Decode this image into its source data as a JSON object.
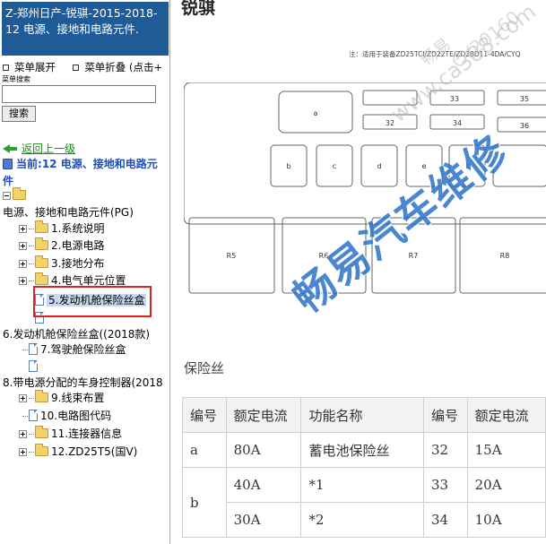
{
  "nav": {
    "title": "Z-郑州日产-锐骐-2015-2018- 12 电源、接地和电路元件.",
    "menu_expand": "菜单展开",
    "menu_collapse": "菜单折叠",
    "menu_hint": "(点击+",
    "search_label": "菜单搜索",
    "search_value": "",
    "search_button": "搜索",
    "back_link": "返回上一级",
    "current_prefix": "当前:",
    "current_name": "12 电源、接地和电路元件"
  },
  "tree": {
    "root_label": "电源、接地和电路元件(PG)",
    "items": [
      {
        "label": "1.系统说明"
      },
      {
        "label": "2.电源电路"
      },
      {
        "label": "3.接地分布"
      },
      {
        "label": "4.电气单元位置"
      },
      {
        "label": "5.发动机舱保险丝盒"
      },
      {
        "label": "6.发动机舱保险丝盒((2018款)"
      },
      {
        "label": "7.驾驶舱保险丝盒"
      },
      {
        "label": "8.带电源分配的车身控制器(2018"
      },
      {
        "label": "9.线束布置"
      },
      {
        "label": "10.电路图代码"
      },
      {
        "label": "11.连接器信息"
      },
      {
        "label": "12.ZD25T5(国V)"
      }
    ]
  },
  "doc": {
    "heading": "锐骐",
    "note": "注：适用于装备ZD25TCI/ZD22TE/ZD28D11-4DA/CYQ",
    "diagram_labels": {
      "a": "a",
      "b": "b",
      "c": "c",
      "d": "d",
      "e": "e",
      "f": "f",
      "f32": "32",
      "f33": "33",
      "f34": "34",
      "f35": "35",
      "f36": "36",
      "r5": "R5",
      "r6": "R6",
      "r7": "R7",
      "r8": "R8"
    },
    "fuse_section_label": "保险丝",
    "table": {
      "headers": [
        "编号",
        "额定电流",
        "功能名称",
        "编号",
        "额定电流"
      ],
      "rows": [
        [
          "a",
          "80A",
          "蓄电池保险丝",
          "32",
          "15A"
        ],
        [
          "b",
          "40A",
          "*1",
          "33",
          "20A"
        ],
        [
          "",
          "30A",
          "*2",
          "34",
          "10A"
        ]
      ]
    }
  },
  "watermark": {
    "main": "畅易汽车维修",
    "small1": "www.ca388.com",
    "small2": "畅易",
    "small3": "CY20160"
  }
}
